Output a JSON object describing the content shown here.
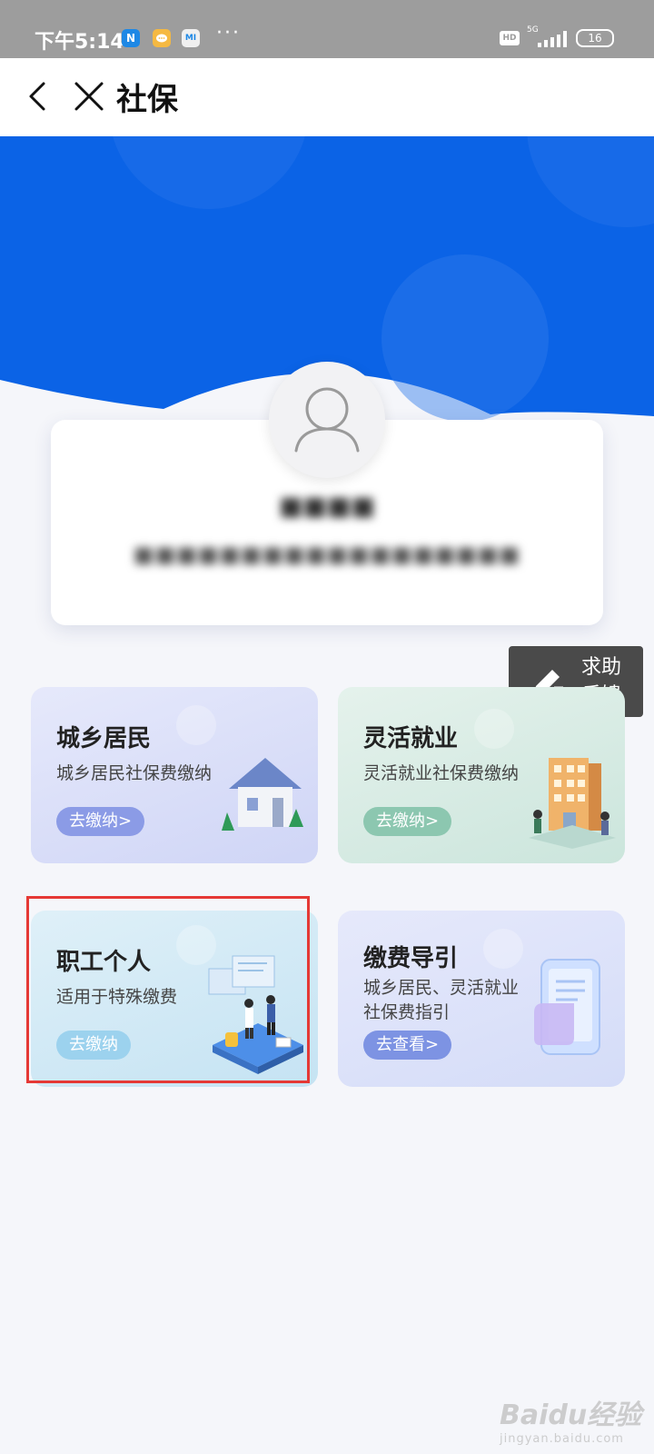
{
  "status_bar": {
    "time": "下午5:14",
    "app_icons": [
      "N",
      "",
      "MI"
    ],
    "more": "···",
    "hd": "HD",
    "network": "5G",
    "battery": "16"
  },
  "nav": {
    "title": "社保",
    "back_icon": "chevron-left-icon",
    "close_icon": "close-icon"
  },
  "colors": {
    "header_blue": "#0b63e6",
    "help_bg": "#4a4a4a",
    "highlight": "#e53935"
  },
  "profile": {
    "avatar_icon": "user-icon"
  },
  "help_button": {
    "label_line1": "求助",
    "label_line2": "反馈",
    "icon": "pencil-icon"
  },
  "cards": {
    "rural": {
      "title": "城乡居民",
      "desc": "城乡居民社保费缴纳",
      "button": "去缴纳>"
    },
    "flex": {
      "title": "灵活就业",
      "desc": "灵活就业社保费缴纳",
      "button": "去缴纳>"
    },
    "worker": {
      "title": "职工个人",
      "desc": "适用于特殊缴费",
      "button": "去缴纳"
    },
    "guide": {
      "title": "缴费导引",
      "desc_line1": "城乡居民、灵活就业",
      "desc_line2": "社保费指引",
      "button": "去查看>"
    }
  },
  "watermark": {
    "logo": "Baidu经验",
    "url": "jingyan.baidu.com"
  }
}
